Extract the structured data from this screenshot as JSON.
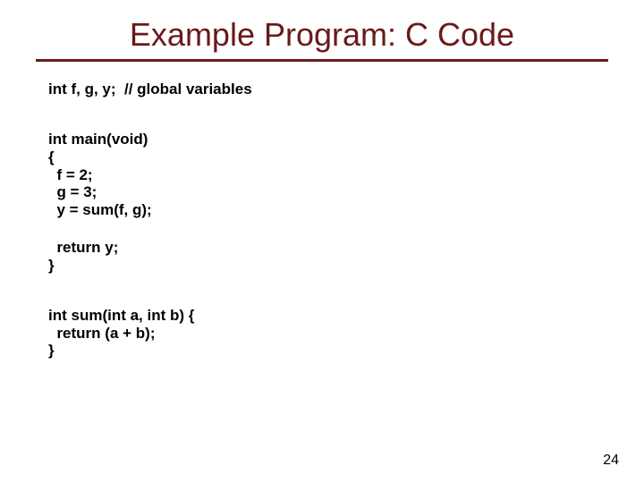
{
  "title": "Example Program: C Code",
  "code": {
    "l1": "int f, g, y;  // global variables",
    "l2": "int main(void)",
    "l3": "{",
    "l4": "  f = 2;",
    "l5": "  g = 3;",
    "l6": "  y = sum(f, g);",
    "l7": "  return y;",
    "l8": "}",
    "l9": "int sum(int a, int b) {",
    "l10": "  return (a + b);",
    "l11": "}"
  },
  "page_number": "24"
}
